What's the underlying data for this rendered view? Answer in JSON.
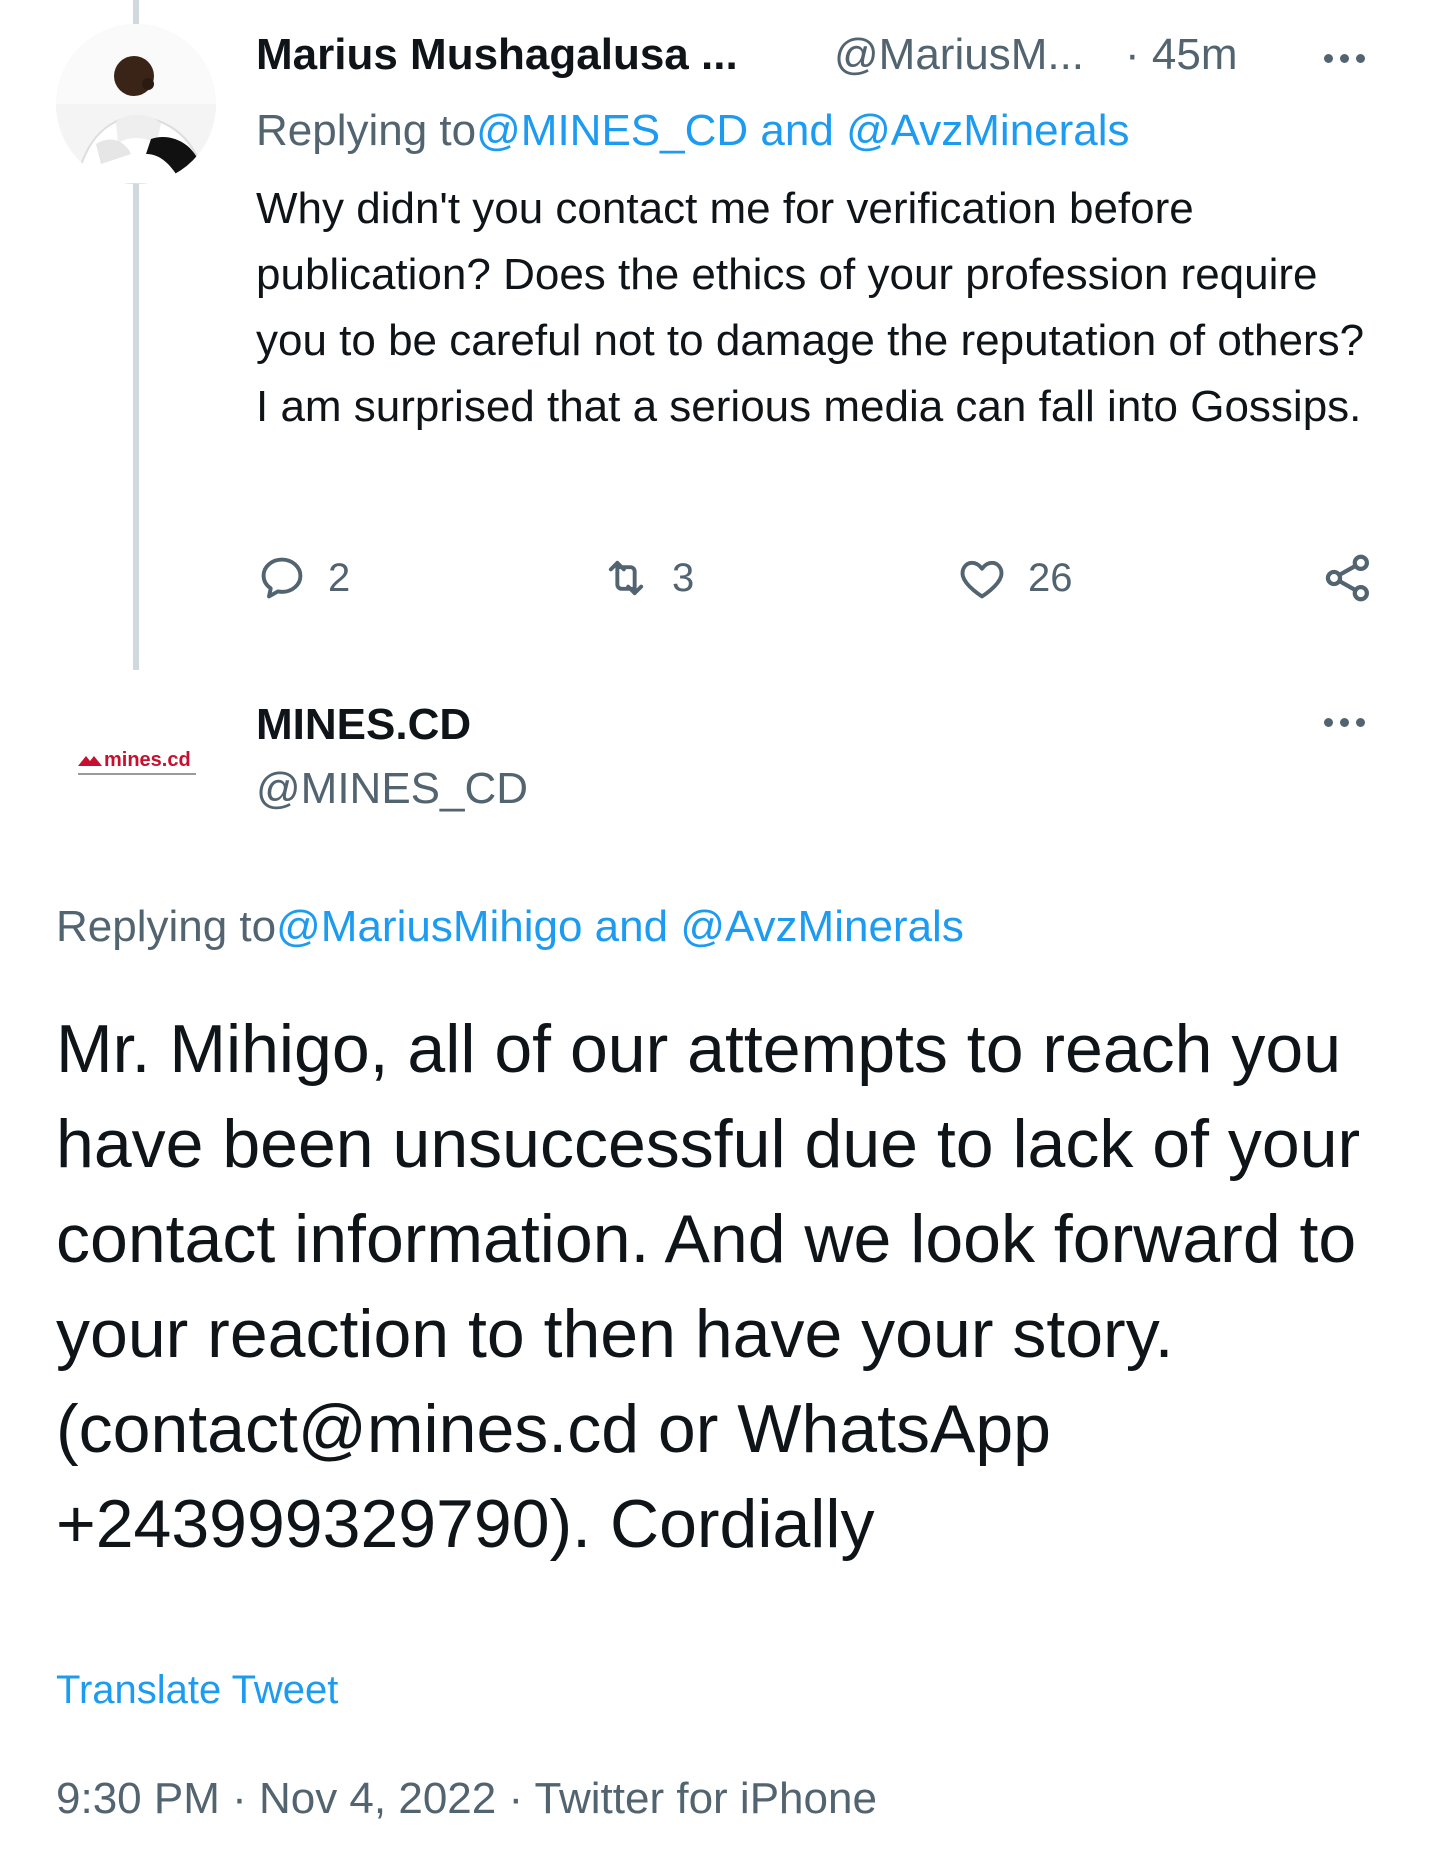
{
  "colors": {
    "accent": "#1d9bf0",
    "secondary_text": "#536471",
    "primary_text": "#0f1419",
    "thread_line": "#cfd9de",
    "logo_red": "#c8102e"
  },
  "reply_tweet": {
    "author_name": "Marius Mushagalusa ...",
    "handle": "@MariusM...",
    "time": "· 45m",
    "replying_prefix": "Replying to",
    "replying_to_1": "@MINES_CD",
    "replying_and": " and ",
    "replying_to_2": "@AvzMinerals",
    "text": "Why didn't you contact me for verification before publication? Does the ethics of your profession require you to be careful not to damage the reputation of others? I am surprised that a serious media can fall into Gossips.",
    "reply_count": "2",
    "retweet_count": "3",
    "like_count": "26",
    "icons": [
      "reply-icon",
      "retweet-icon",
      "like-icon",
      "share-icon",
      "more-icon"
    ]
  },
  "main_tweet": {
    "author_name": "MINES.CD",
    "handle": "@MINES_CD",
    "logo_text": "mines.cd",
    "replying_prefix": "Replying to",
    "replying_to_1": "@MariusMihigo",
    "replying_and": " and ",
    "replying_to_2": "@AvzMinerals",
    "text": "Mr. Mihigo, all of our attempts to reach you have been unsuccessful due to lack of your contact information. And we look forward to your reaction to then have your story. (contact@mines.cd or WhatsApp +243999329790). Cordially",
    "translate_label": "Translate Tweet",
    "meta": "9:30 PM · Nov 4, 2022 · Twitter for iPhone"
  }
}
